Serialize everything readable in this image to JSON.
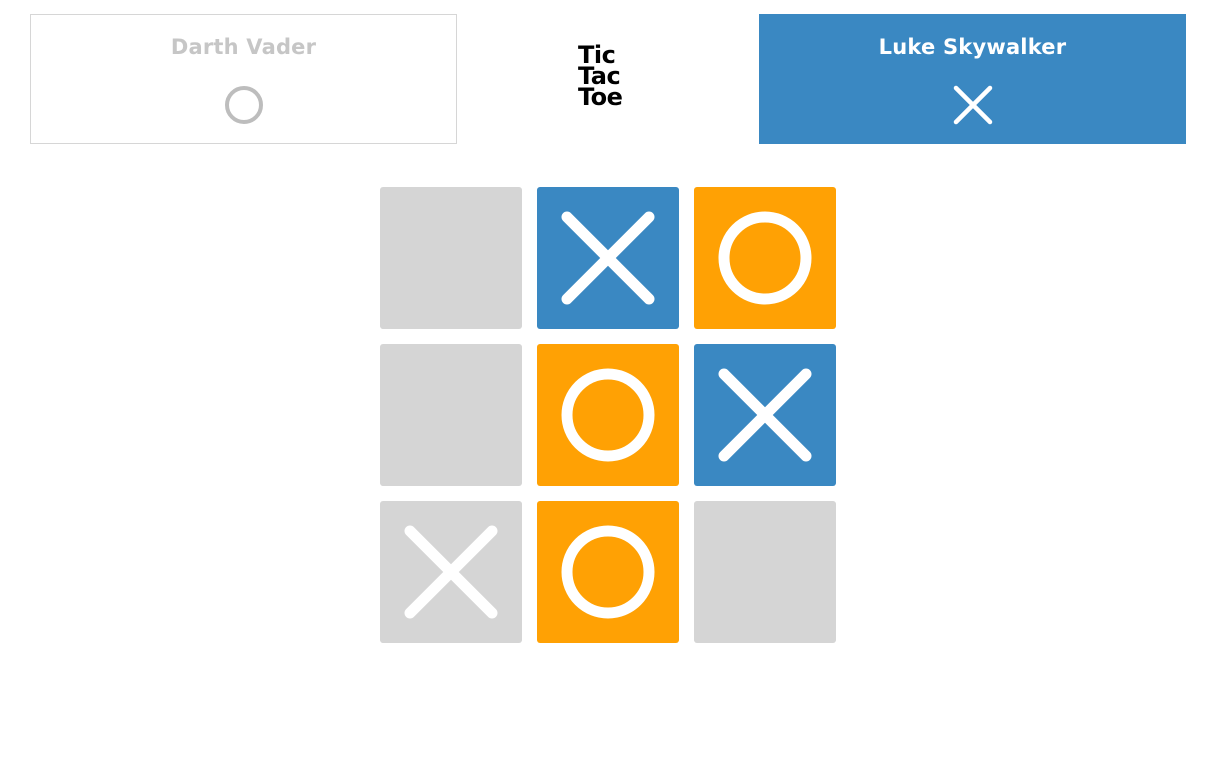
{
  "players": {
    "left": {
      "name": "Darth Vader",
      "symbol": "O",
      "active": false
    },
    "right": {
      "name": "Luke Skywalker",
      "symbol": "X",
      "active": true
    }
  },
  "logo": {
    "lines": [
      "Tic",
      "Tac",
      "Toe"
    ]
  },
  "board": {
    "cells": [
      {
        "mark": "",
        "state": "empty"
      },
      {
        "mark": "X",
        "state": "x"
      },
      {
        "mark": "O",
        "state": "o"
      },
      {
        "mark": "",
        "state": "empty"
      },
      {
        "mark": "O",
        "state": "o"
      },
      {
        "mark": "X",
        "state": "x"
      },
      {
        "mark": "X",
        "state": "preview"
      },
      {
        "mark": "O",
        "state": "o"
      },
      {
        "mark": "",
        "state": "empty"
      }
    ]
  },
  "colors": {
    "x": "#3a88c2",
    "o": "#ffa104",
    "empty": "#d5d5d5",
    "mark": "#ffffff",
    "inactive_text": "#c6c6c6",
    "inactive_symbol": "#bdbdbd",
    "active_text": "#ffffff"
  }
}
